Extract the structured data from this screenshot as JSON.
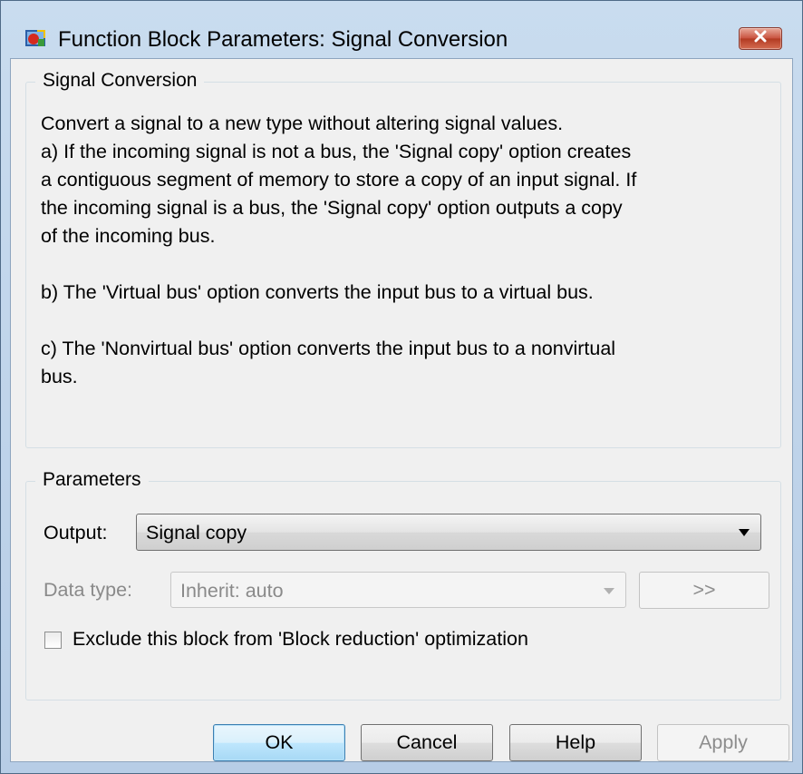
{
  "window": {
    "title": "Function Block Parameters: Signal Conversion"
  },
  "icons": {
    "app": "simulink-block-icon",
    "close": "close-icon",
    "dropdown": "chevron-down-icon"
  },
  "description_group": {
    "legend": "Signal Conversion",
    "lines": [
      "Convert a signal to a new type without altering signal values.",
      "a) If the incoming signal is not a bus, the 'Signal copy' option creates",
      "a contiguous segment of memory to store a copy of an input signal. If",
      "the incoming signal is a bus, the 'Signal copy' option outputs a copy",
      "of the incoming bus.",
      "",
      "b) The 'Virtual bus' option converts the input bus to a virtual bus.",
      "",
      "c) The 'Nonvirtual bus' option converts the input bus to a nonvirtual",
      "bus."
    ]
  },
  "parameters_group": {
    "legend": "Parameters",
    "output_label": "Output:",
    "output_value": "Signal copy",
    "datatype_label": "Data type:",
    "datatype_value": "Inherit: auto",
    "datatype_assistant_label": ">>",
    "datatype_enabled": false,
    "checkbox_label": "Exclude this block from 'Block reduction' optimization",
    "checkbox_checked": false
  },
  "buttons": {
    "ok": "OK",
    "cancel": "Cancel",
    "help": "Help",
    "apply": "Apply",
    "apply_enabled": false
  },
  "colors": {
    "titlebar": "#c9dcef",
    "client_bg": "#f0f0f0",
    "close_button": "#c8513d",
    "default_button": "#bee6fd",
    "disabled_text": "#8a8a8a"
  }
}
